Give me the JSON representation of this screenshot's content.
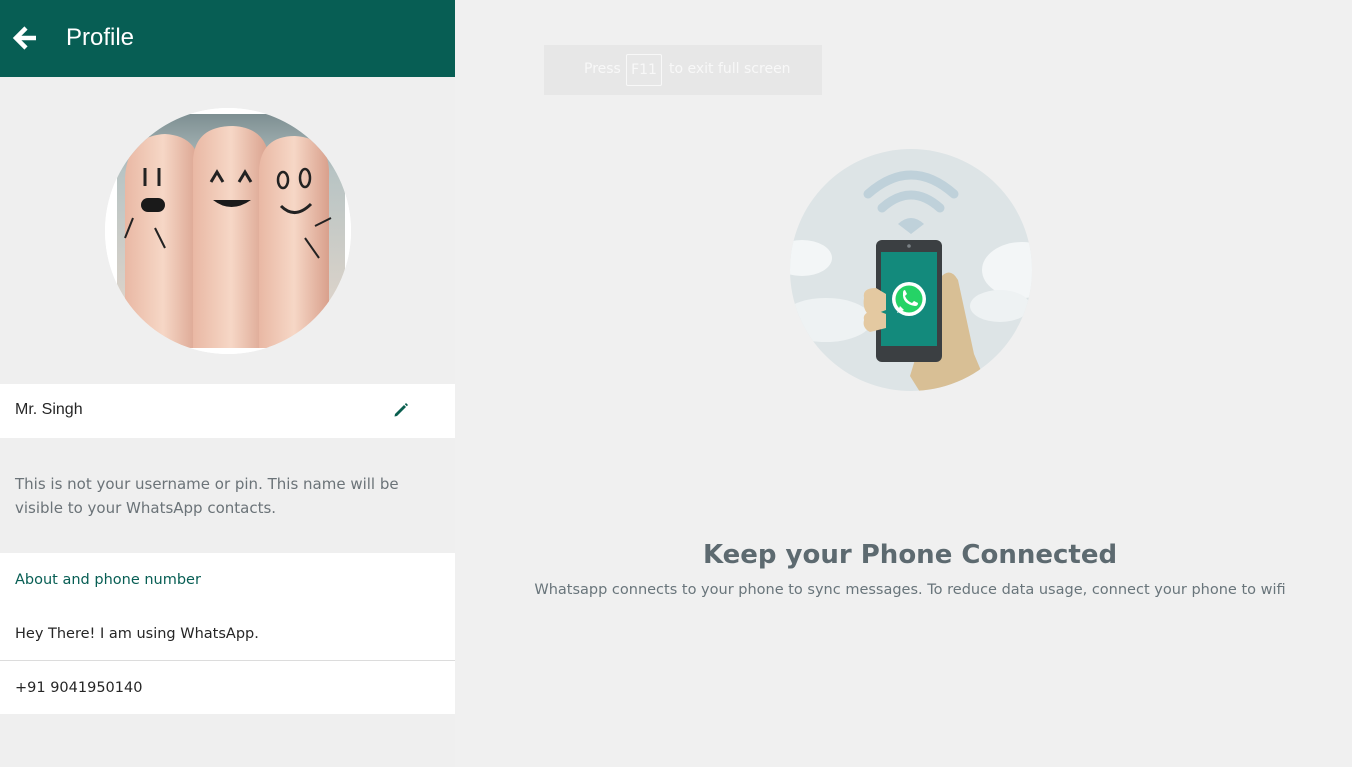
{
  "header": {
    "title": "Profile",
    "color": "#075e54"
  },
  "profile": {
    "name": "Mr. Singh",
    "name_note": "This is not your username or pin. This name will be visible to your WhatsApp contacts.",
    "about_heading": "About and phone number",
    "about_status": "Hey There! I am using WhatsApp.",
    "phone": "+91 9041950140"
  },
  "fullscreen_notice": {
    "press": "Press",
    "key": "F11",
    "rest": "to exit full screen"
  },
  "connection": {
    "title": "Keep your Phone Connected",
    "subtitle": "Whatsapp connects to your phone to sync messages. To reduce data usage, connect your phone to wifi"
  },
  "icons": {
    "back": "arrow-left-icon",
    "edit": "pencil-icon",
    "illustration": "phone-wifi-illustration"
  }
}
